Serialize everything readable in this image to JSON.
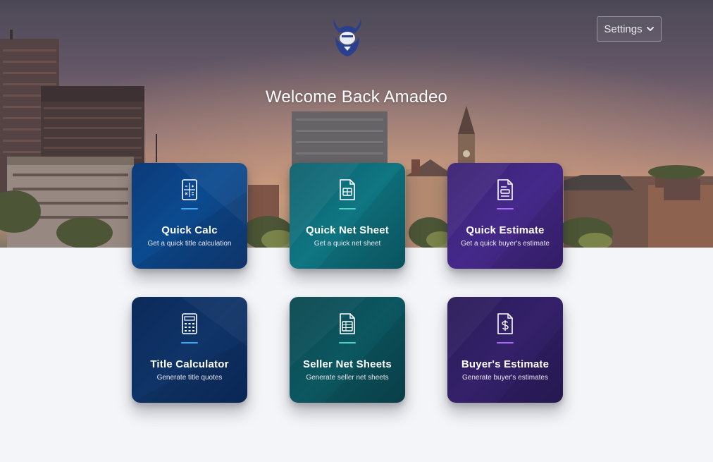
{
  "header": {
    "logo_icon": "viking-mascot-logo",
    "settings_label": "Settings",
    "settings_icon": "chevron-down-icon"
  },
  "welcome": {
    "title": "Welcome Back Amadeo"
  },
  "cards": [
    {
      "title": "Quick Calc",
      "subtitle": "Get a quick title calculation",
      "icon": "calculator-doc-icon",
      "accent": "#3da9f0"
    },
    {
      "title": "Quick Net Sheet",
      "subtitle": "Get a quick net sheet",
      "icon": "spreadsheet-doc-icon",
      "accent": "#4fd3c3"
    },
    {
      "title": "Quick Estimate",
      "subtitle": "Get a quick buyer's estimate",
      "icon": "estimate-doc-icon",
      "accent": "#a66bff"
    },
    {
      "title": "Title Calculator",
      "subtitle": "Generate title quotes",
      "icon": "calculator-icon",
      "accent": "#3da9f0"
    },
    {
      "title": "Seller Net Sheets",
      "subtitle": "Generate seller net sheets",
      "icon": "table-doc-icon",
      "accent": "#4fd3c3"
    },
    {
      "title": "Buyer's Estimate",
      "subtitle": "Generate buyer's estimates",
      "icon": "dollar-doc-icon",
      "accent": "#a66bff"
    }
  ],
  "colors": {
    "page_background": "#f4f5f8",
    "card_blue": "#0b4a8f",
    "card_teal": "#0f7682",
    "card_purple": "#45298a"
  }
}
